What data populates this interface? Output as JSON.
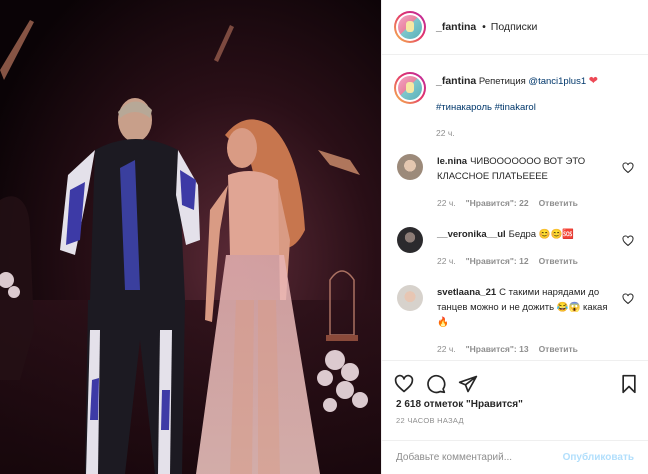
{
  "post": {
    "username": "_fantina",
    "separator": "•",
    "follow_label": "Подписки",
    "caption_text": "Репетиция",
    "caption_mention": "@tanci1plus1",
    "caption_emoji": "❤",
    "hashtags": "#тинакароль #tinakarol",
    "caption_time": "22 ч."
  },
  "comments": [
    {
      "user": "le.nina",
      "text": "ЧИВООООООО ВОТ ЭТО КЛАССНОЕ ПЛАТЬЕЕЕЕ",
      "time": "22 ч.",
      "likes": "\"Нравится\": 22",
      "reply": "Ответить"
    },
    {
      "user": "__veronika__ul",
      "text": "Бедра 😊😊🆘",
      "time": "22 ч.",
      "likes": "\"Нравится\": 12",
      "reply": "Ответить"
    },
    {
      "user": "svetlaana_21",
      "text": "С такими нарядами до танцев можно и не дожить 😂😱 какая 🔥",
      "time": "22 ч.",
      "likes": "\"Нравится\": 13",
      "reply": "Ответить"
    }
  ],
  "stats": {
    "likes_count": "2 618 отметок",
    "likes_label": "\"Нравится\"",
    "posted_time": "22 ЧАСОВ НАЗАД"
  },
  "composer": {
    "placeholder": "Добавьте комментарий...",
    "publish_label": "Опубликовать"
  },
  "icons": {
    "like": "heart-icon",
    "comment": "comment-icon",
    "share": "paper-plane-icon",
    "save": "bookmark-icon"
  },
  "colors": {
    "link": "#00376b",
    "muted": "#8e8e8e",
    "heart": "#ed4956",
    "publish_disabled": "#b2dffc"
  }
}
